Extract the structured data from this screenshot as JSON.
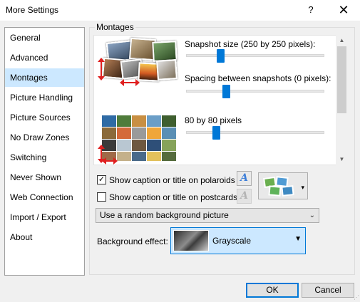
{
  "window": {
    "title": "More Settings",
    "help_glyph": "?",
    "close_glyph": "✕"
  },
  "sidebar": {
    "items": [
      {
        "label": "General"
      },
      {
        "label": "Advanced"
      },
      {
        "label": "Montages",
        "active": true
      },
      {
        "label": "Picture Handling"
      },
      {
        "label": "Picture Sources"
      },
      {
        "label": "No Draw Zones"
      },
      {
        "label": "Switching"
      },
      {
        "label": "Never Shown"
      },
      {
        "label": "Web Connection"
      },
      {
        "label": "Import / Export"
      },
      {
        "label": "About"
      }
    ]
  },
  "montages": {
    "group_label": "Montages",
    "snapshot_size": {
      "label": "Snapshot size (250 by 250 pixels):",
      "value_fraction": 0.25
    },
    "spacing": {
      "label": "Spacing between snapshots (0 pixels):",
      "value_fraction": 0.29
    },
    "grid_size": {
      "label": "80 by 80 pixels",
      "value_fraction": 0.22
    }
  },
  "options": {
    "caption_polaroids": {
      "label": "Show caption or title on polaroids",
      "checked": true,
      "check_glyph": "✓"
    },
    "caption_postcards": {
      "label": "Show caption or title on postcards",
      "checked": false
    },
    "font_glyph": "A",
    "dropdown_glyph": "▾"
  },
  "background": {
    "selected": "Use a random background picture",
    "chevron": "⌄"
  },
  "effect": {
    "label": "Background effect:",
    "selected": "Grayscale",
    "arrow": "▼"
  },
  "buttons": {
    "ok": "OK",
    "cancel": "Cancel"
  },
  "scroll": {
    "up": "▲",
    "down": "▼"
  },
  "grip": "⋰",
  "colors": {
    "accent": "#0078d7",
    "selection": "#cce8ff",
    "arrow_red": "#e02020"
  }
}
